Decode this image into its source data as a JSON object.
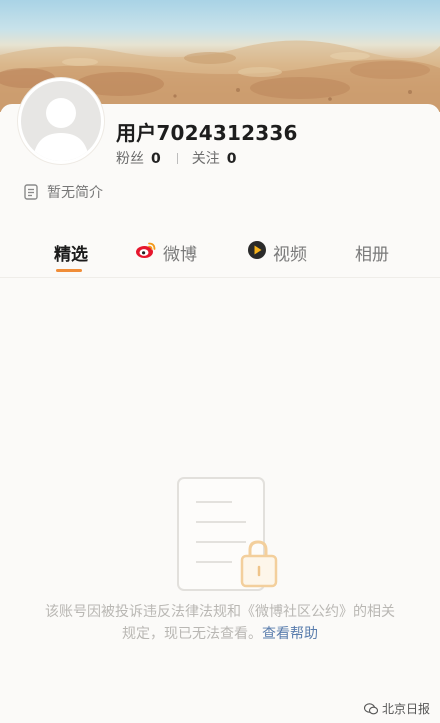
{
  "profile": {
    "username": "用户7024312336",
    "fans_label": "粉丝",
    "fans_count": "0",
    "following_label": "关注",
    "following_count": "0",
    "bio": "暂无简介"
  },
  "tabs": [
    {
      "label": "精选",
      "icon": "",
      "active": true
    },
    {
      "label": "微博",
      "icon": "weibo-icon",
      "active": false
    },
    {
      "label": "视频",
      "icon": "video-icon",
      "active": false
    },
    {
      "label": "相册",
      "icon": "",
      "active": false
    }
  ],
  "empty_state": {
    "notice_text": "该账号因被投诉违反法律法规和《微博社区公约》的相关规定，现已无法查看。",
    "help_link": "查看帮助",
    "icon": "locked-document-icon"
  },
  "watermark": {
    "text": "北京日报"
  },
  "colors": {
    "accent": "#f08d38",
    "link": "#5a7dad",
    "muted_text": "#b9b7b3"
  }
}
